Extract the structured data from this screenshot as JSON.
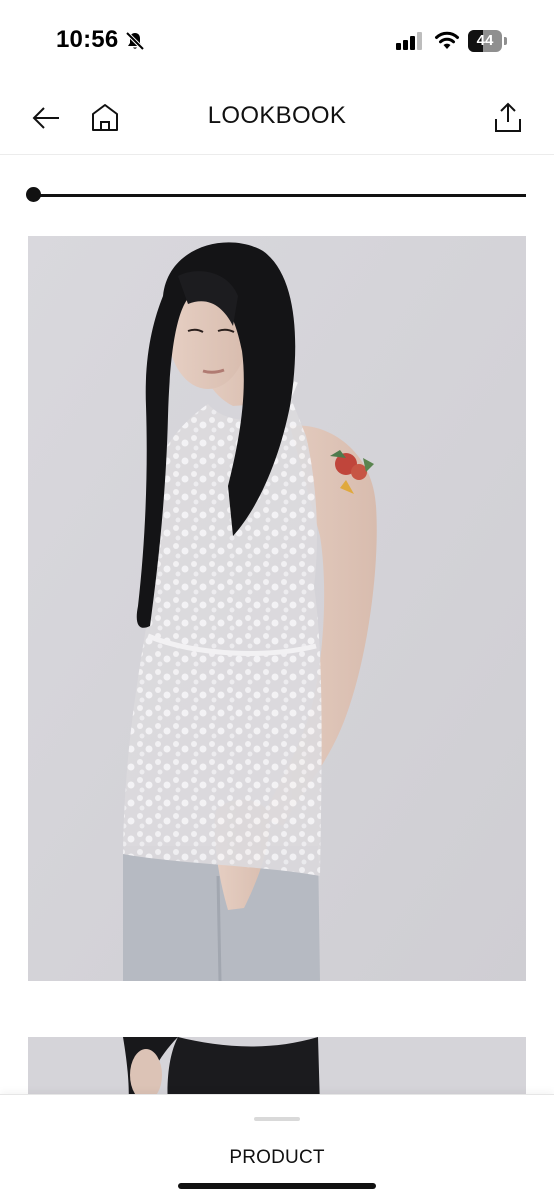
{
  "status_bar": {
    "time": "10:56",
    "battery_level": "44",
    "battery_fraction": 0.44,
    "icons": [
      "bell-muted-icon",
      "signal-icon",
      "wifi-icon",
      "battery-icon"
    ]
  },
  "header": {
    "title": "LOOKBOOK",
    "icons": [
      "back-arrow-icon",
      "home-icon",
      "share-icon"
    ]
  },
  "slider": {
    "position": 0
  },
  "gallery": {
    "photos": [
      {
        "name": "lookbook-photo-1"
      },
      {
        "name": "lookbook-photo-2"
      }
    ]
  },
  "bottom_sheet": {
    "label": "PRODUCT"
  },
  "colors": {
    "background": "#ffffff",
    "text": "#111111",
    "photo_backdrop": "#d6d5da",
    "divider": "#ececec"
  }
}
